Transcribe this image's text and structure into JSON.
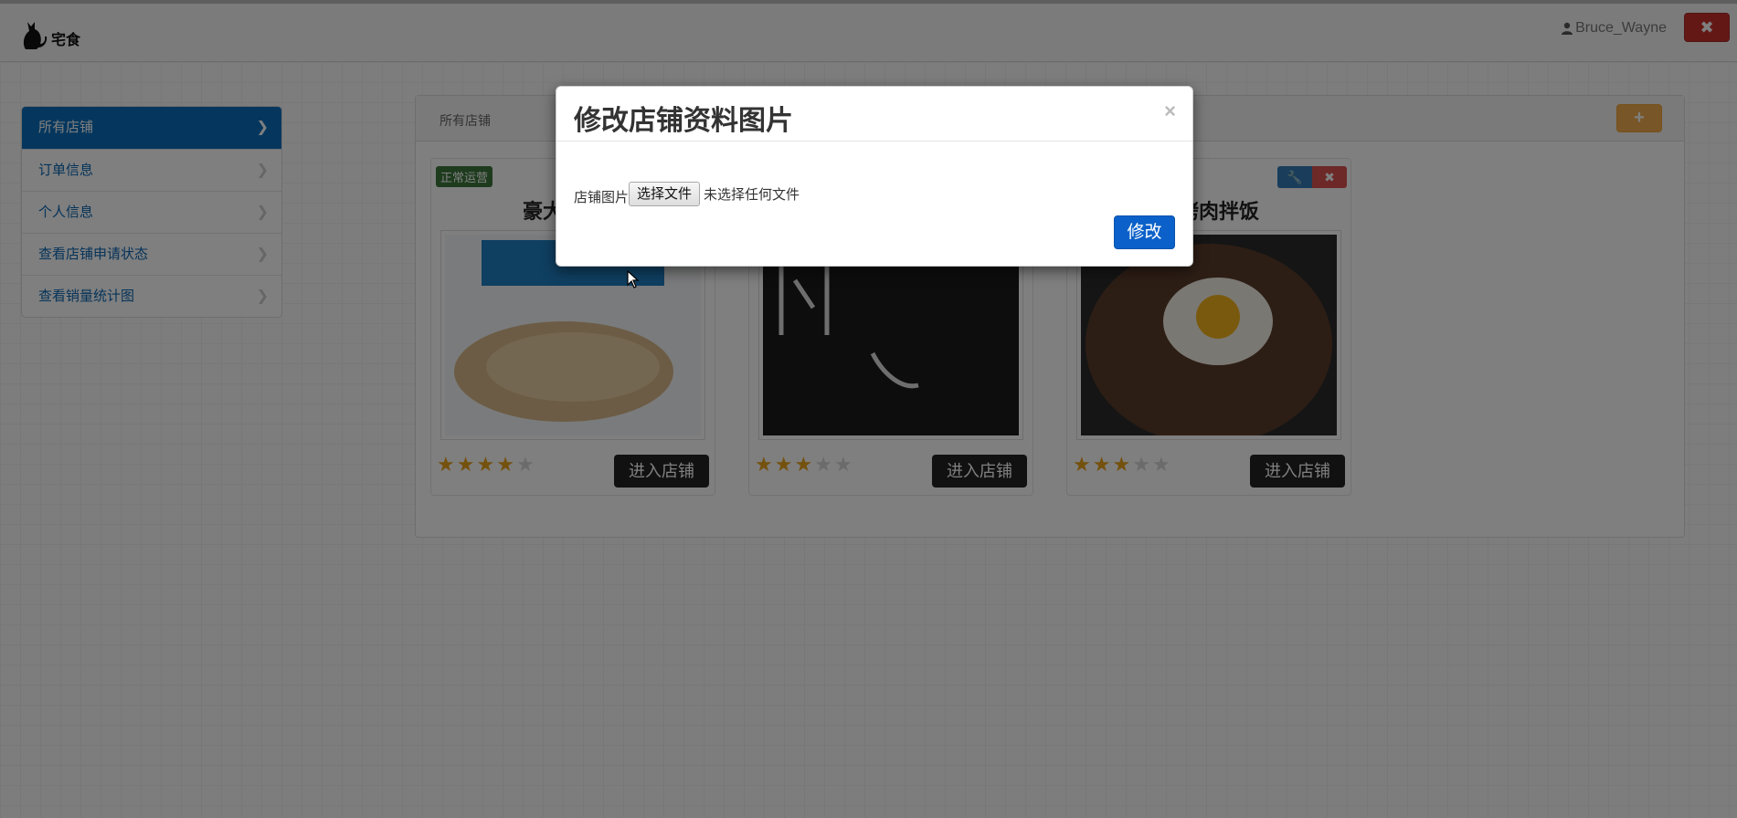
{
  "navbar": {
    "brand_name": "宅食",
    "user_name": "Bruce_Wayne",
    "logout_symbol": "✖"
  },
  "sidebar": {
    "items": [
      {
        "label": "所有店铺",
        "active": true
      },
      {
        "label": "订单信息"
      },
      {
        "label": "个人信息"
      },
      {
        "label": "查看店铺申请状态"
      },
      {
        "label": "查看销量统计图"
      }
    ],
    "chevron": "❯"
  },
  "panel": {
    "breadcrumb": "所有店铺",
    "add_symbol": "+"
  },
  "shops": [
    {
      "status": "正常运营",
      "title": "豪大大鸡排",
      "rating": 4,
      "enter_label": "进入店铺"
    },
    {
      "title": "",
      "rating": 3,
      "enter_label": "进入店铺"
    },
    {
      "title": "饭烤肉拌饭",
      "rating": 3,
      "enter_label": "进入店铺",
      "edit_symbol": "🔧",
      "delete_symbol": "✖"
    }
  ],
  "modal": {
    "title": "修改店铺资料图片",
    "close_symbol": "×",
    "file_label": "店铺图片",
    "file_button": "选择文件",
    "file_status": "未选择任何文件",
    "submit_label": "修改"
  },
  "colors": {
    "primary": "#0a6ebd",
    "modal_button": "#0b61c9",
    "danger": "#d9534f",
    "warning": "#f0ad4e",
    "success": "#3c763d",
    "star": "#e8a21b"
  },
  "icons": [
    "cat-logo-icon",
    "user-icon",
    "close-icon",
    "chevron-right-icon",
    "plus-icon",
    "wrench-icon",
    "star-icon",
    "mouse-cursor-icon"
  ]
}
